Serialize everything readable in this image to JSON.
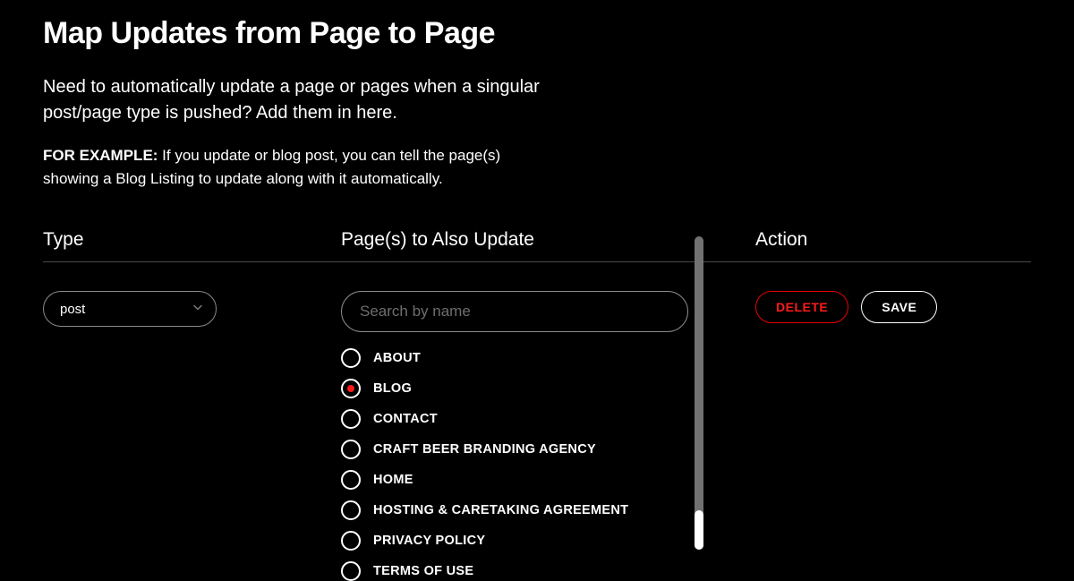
{
  "header": {
    "title": "Map Updates from Page to Page",
    "subtitle": "Need to automatically update a page or pages when a singular post/page type is pushed? Add them in here.",
    "example_prefix": "FOR EXAMPLE:",
    "example_text": " If you update or blog post, you can tell the page(s) showing a Blog Listing to update along with it automatically."
  },
  "columns": {
    "type": "Type",
    "pages": "Page(s) to Also Update",
    "action": "Action"
  },
  "type_select": {
    "value": "post"
  },
  "search": {
    "placeholder": "Search by name",
    "value": ""
  },
  "pages": [
    {
      "label": "ABOUT",
      "selected": false
    },
    {
      "label": "BLOG",
      "selected": true
    },
    {
      "label": "CONTACT",
      "selected": false
    },
    {
      "label": "CRAFT BEER BRANDING AGENCY",
      "selected": false
    },
    {
      "label": "HOME",
      "selected": false
    },
    {
      "label": "HOSTING & CARETAKING AGREEMENT",
      "selected": false
    },
    {
      "label": "PRIVACY POLICY",
      "selected": false
    },
    {
      "label": "TERMS OF USE",
      "selected": false
    }
  ],
  "actions": {
    "delete": "DELETE",
    "save": "SAVE"
  },
  "colors": {
    "accent_red": "#ff1a1a"
  }
}
